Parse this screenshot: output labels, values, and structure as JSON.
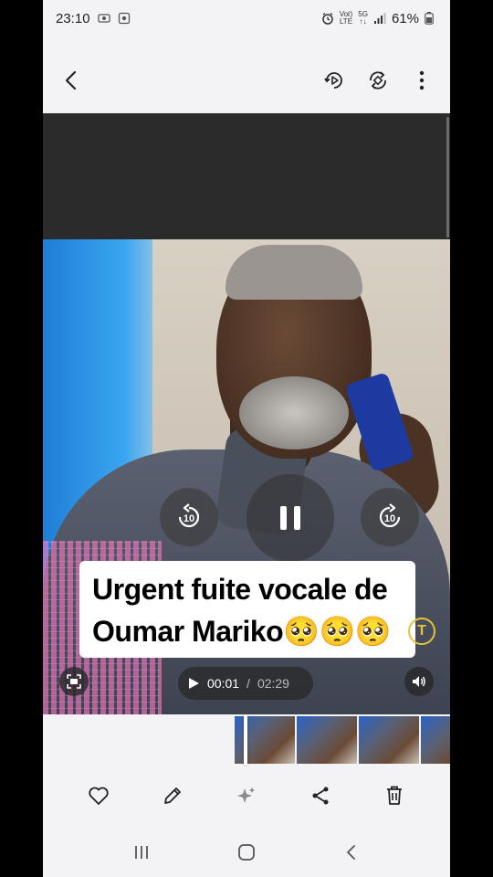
{
  "status_bar": {
    "time": "23:10",
    "network_top": "Voℓ)",
    "network_bottom": "LTE",
    "signal_top": "5G",
    "signal_bottom": "↑↓",
    "battery_percent": "61%"
  },
  "app_bar": {
    "icons": [
      "back-icon",
      "motion-photo-icon",
      "rotate-icon",
      "more-options-icon"
    ]
  },
  "video": {
    "caption_line1": "Urgent fuite vocale de",
    "caption_line2": "Oumar Mariko🥺🥺🥺",
    "rewind_label": "10",
    "forward_label": "10",
    "current_time": "00:01",
    "separator": "/",
    "duration": "02:29",
    "t_badge": "T"
  },
  "toolbar": {
    "icons": [
      "heart-icon",
      "edit-icon",
      "sparkle-icon",
      "share-icon",
      "trash-icon"
    ]
  },
  "navbar": {
    "icons": [
      "recents-icon",
      "home-icon",
      "back-nav-icon"
    ]
  },
  "colors": {
    "background": "#f3f3f5",
    "text": "#222222",
    "badge_yellow": "#e6c23a"
  }
}
